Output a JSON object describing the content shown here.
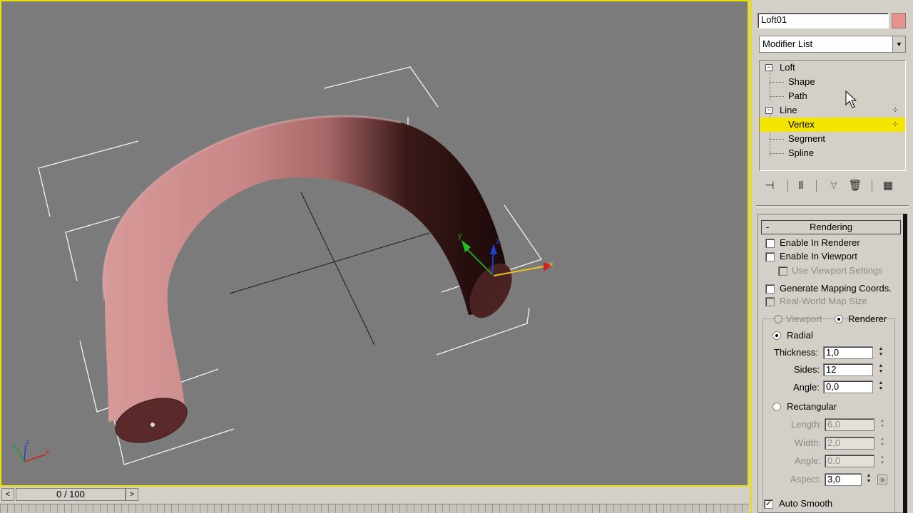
{
  "object": {
    "name": "Loft01",
    "color": "#e8908c"
  },
  "modifier_list": {
    "label": "Modifier List"
  },
  "stack": {
    "items": [
      {
        "label": "Loft"
      },
      {
        "label": "Shape"
      },
      {
        "label": "Path"
      },
      {
        "label": "Line"
      },
      {
        "label": "Vertex"
      },
      {
        "label": "Segment"
      },
      {
        "label": "Spline"
      }
    ]
  },
  "stack_tools": {
    "icons": [
      "pin-stack-icon",
      "show-end-result-icon",
      "make-unique-icon",
      "remove-modifier-icon",
      "configure-modifier-sets-icon"
    ]
  },
  "rendering": {
    "title": "Rendering",
    "collapse": "-",
    "enable_in_renderer": "Enable In Renderer",
    "enable_in_viewport": "Enable In Viewport",
    "use_viewport_settings": "Use Viewport Settings",
    "generate_mapping": "Generate Mapping Coords.",
    "real_world_map": "Real-World Map Size",
    "viewport": "Viewport",
    "renderer": "Renderer",
    "radial": "Radial",
    "thickness_label": "Thickness:",
    "thickness": "1,0",
    "sides_label": "Sides:",
    "sides": "12",
    "angle_label": "Angle:",
    "angle": "0,0",
    "rectangular": "Rectangular",
    "length_label": "Length:",
    "length": "6,0",
    "width_label": "Width:",
    "width": "2,0",
    "rect_angle_label": "Angle:",
    "rect_angle": "0,0",
    "aspect_label": "Aspect:",
    "aspect": "3,0",
    "auto_smooth": "Auto Smooth"
  },
  "timeline": {
    "frame": "0 / 100",
    "prev": "<",
    "next": ">"
  },
  "viewport": {
    "axis_x": "x",
    "axis_y": "y",
    "axis_z": "z",
    "mesh_color": "#c98686"
  }
}
